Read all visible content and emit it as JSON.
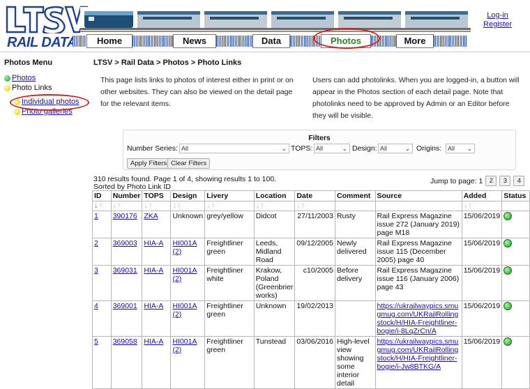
{
  "header": {
    "logo_text": "LTSV",
    "logo_subtitle": "RAIL DATA",
    "login_label": "Log-in",
    "register_label": "Register",
    "nav": [
      "Home",
      "News",
      "Data",
      "Photos",
      "More"
    ],
    "active_nav": "Photos"
  },
  "sidebar": {
    "title": "Photos Menu",
    "items": [
      {
        "label": "Photos",
        "link": true
      },
      {
        "label": "Photo Links",
        "link": false
      },
      {
        "label": "Individual photos",
        "link": true
      },
      {
        "label": "Photo galleries",
        "link": true
      }
    ]
  },
  "breadcrumb": "LTSV > Rail Data > Photos > Photo Links",
  "intro_left": "This page lists links to photos of interest either in print or on other websites. They can also be viewed on the detail page for the relevant items.",
  "intro_right": "Users can add photolinks. When you are logged-in, a button will appear in the Photos section of each detail page. Note that photolinks need to be approved by Admin or an Editor before they will be visible.",
  "filters": {
    "title": "Filters",
    "number_series_label": "Number Series:",
    "number_series_value": "All",
    "tops_label": "TOPS:",
    "tops_value": "All",
    "design_label": "Design:",
    "design_value": "All",
    "origins_label": "Origins:",
    "origins_value": "All",
    "apply_label": "Apply Filters",
    "clear_label": "Clear Filters"
  },
  "results": {
    "summary": "310 results found. Page 1 of 4, showing results 1 to 100.",
    "sort_text": "Sorted by Photo Link ID",
    "jump_label": "Jump to page:",
    "current_page": "1",
    "pages": [
      "2",
      "3",
      "4"
    ]
  },
  "table": {
    "headers": [
      "ID",
      "Number",
      "TOPS",
      "Design",
      "Livery",
      "Location",
      "Date",
      "Comment",
      "Source",
      "Added",
      "Status"
    ],
    "rows": [
      {
        "id": "1",
        "number": "390176",
        "tops": "ZKA",
        "design": "Unknown",
        "livery": "grey/yellow",
        "location": "Didcot",
        "date": "27/11/2003",
        "comment": "Rusty",
        "source": "Rail Express Magazine issue 272 (January 2019) page M18",
        "added": "15/06/2019",
        "status": "approved"
      },
      {
        "id": "2",
        "number": "369003",
        "tops": "HIA-A",
        "design": "HI001A (2)",
        "livery": "Freightliner green",
        "location": "Leeds, Midland Road",
        "date": "09/12/2005",
        "comment": "Newly delivered",
        "source": "Rail Express Magazine issue 115 (December 2005) page 40",
        "added": "15/06/2019",
        "status": "approved"
      },
      {
        "id": "3",
        "number": "369031",
        "tops": "HIA-A",
        "design": "HI001A (2)",
        "livery": "Freightliner white",
        "location": "Krakow, Poland (Greenbrier works)",
        "date": "c10/2005",
        "comment": "Before delivery",
        "source": "Rail Express Magazine issue 116 (January 2006) page 43",
        "added": "15/06/2019",
        "status": "approved"
      },
      {
        "id": "4",
        "number": "369001",
        "tops": "HIA-A",
        "design": "HI001A (2)",
        "livery": "Freightliner green",
        "location": "Unknown",
        "date": "19/02/2013",
        "comment": "",
        "source": "https://ukrailwaypics.smugmug.com/UKRailRollingstock/H/HIA-Freightliner-bogie/i-8LqZrCn/A",
        "added": "15/06/2019",
        "status": "approved"
      },
      {
        "id": "5",
        "number": "369058",
        "tops": "HIA-A",
        "design": "HI001A (2)",
        "livery": "Freightliner green",
        "location": "Tunstead",
        "date": "03/06/2016",
        "comment": "High-level view showing some interior detail",
        "source": "https://ukrailwaypics.smugmug.com/UKRailRollingstock/H/HIA-Freightliner-bogie/i-Jw8BTKG/A",
        "added": "15/06/2019",
        "status": "approved"
      }
    ]
  },
  "colors": {
    "brand_blue": "#1e3f9a",
    "link": "#1a0dab",
    "highlight_red": "#d62020",
    "status_green": "#1e9e1e"
  }
}
